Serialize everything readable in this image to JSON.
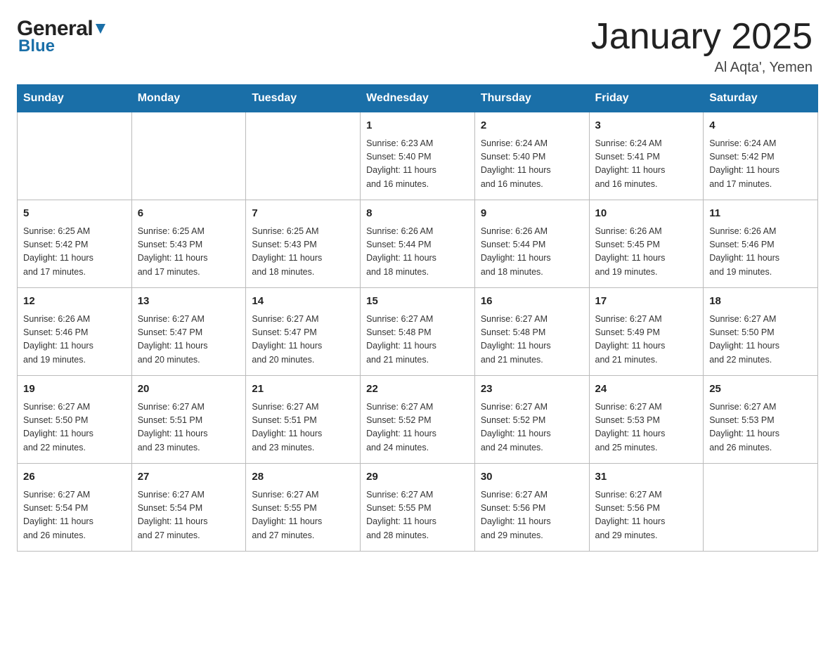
{
  "header": {
    "title": "January 2025",
    "location": "Al Aqta', Yemen",
    "logo_general": "General",
    "logo_blue": "Blue"
  },
  "weekdays": [
    "Sunday",
    "Monday",
    "Tuesday",
    "Wednesday",
    "Thursday",
    "Friday",
    "Saturday"
  ],
  "weeks": [
    [
      {
        "day": "",
        "info": ""
      },
      {
        "day": "",
        "info": ""
      },
      {
        "day": "",
        "info": ""
      },
      {
        "day": "1",
        "info": "Sunrise: 6:23 AM\nSunset: 5:40 PM\nDaylight: 11 hours\nand 16 minutes."
      },
      {
        "day": "2",
        "info": "Sunrise: 6:24 AM\nSunset: 5:40 PM\nDaylight: 11 hours\nand 16 minutes."
      },
      {
        "day": "3",
        "info": "Sunrise: 6:24 AM\nSunset: 5:41 PM\nDaylight: 11 hours\nand 16 minutes."
      },
      {
        "day": "4",
        "info": "Sunrise: 6:24 AM\nSunset: 5:42 PM\nDaylight: 11 hours\nand 17 minutes."
      }
    ],
    [
      {
        "day": "5",
        "info": "Sunrise: 6:25 AM\nSunset: 5:42 PM\nDaylight: 11 hours\nand 17 minutes."
      },
      {
        "day": "6",
        "info": "Sunrise: 6:25 AM\nSunset: 5:43 PM\nDaylight: 11 hours\nand 17 minutes."
      },
      {
        "day": "7",
        "info": "Sunrise: 6:25 AM\nSunset: 5:43 PM\nDaylight: 11 hours\nand 18 minutes."
      },
      {
        "day": "8",
        "info": "Sunrise: 6:26 AM\nSunset: 5:44 PM\nDaylight: 11 hours\nand 18 minutes."
      },
      {
        "day": "9",
        "info": "Sunrise: 6:26 AM\nSunset: 5:44 PM\nDaylight: 11 hours\nand 18 minutes."
      },
      {
        "day": "10",
        "info": "Sunrise: 6:26 AM\nSunset: 5:45 PM\nDaylight: 11 hours\nand 19 minutes."
      },
      {
        "day": "11",
        "info": "Sunrise: 6:26 AM\nSunset: 5:46 PM\nDaylight: 11 hours\nand 19 minutes."
      }
    ],
    [
      {
        "day": "12",
        "info": "Sunrise: 6:26 AM\nSunset: 5:46 PM\nDaylight: 11 hours\nand 19 minutes."
      },
      {
        "day": "13",
        "info": "Sunrise: 6:27 AM\nSunset: 5:47 PM\nDaylight: 11 hours\nand 20 minutes."
      },
      {
        "day": "14",
        "info": "Sunrise: 6:27 AM\nSunset: 5:47 PM\nDaylight: 11 hours\nand 20 minutes."
      },
      {
        "day": "15",
        "info": "Sunrise: 6:27 AM\nSunset: 5:48 PM\nDaylight: 11 hours\nand 21 minutes."
      },
      {
        "day": "16",
        "info": "Sunrise: 6:27 AM\nSunset: 5:48 PM\nDaylight: 11 hours\nand 21 minutes."
      },
      {
        "day": "17",
        "info": "Sunrise: 6:27 AM\nSunset: 5:49 PM\nDaylight: 11 hours\nand 21 minutes."
      },
      {
        "day": "18",
        "info": "Sunrise: 6:27 AM\nSunset: 5:50 PM\nDaylight: 11 hours\nand 22 minutes."
      }
    ],
    [
      {
        "day": "19",
        "info": "Sunrise: 6:27 AM\nSunset: 5:50 PM\nDaylight: 11 hours\nand 22 minutes."
      },
      {
        "day": "20",
        "info": "Sunrise: 6:27 AM\nSunset: 5:51 PM\nDaylight: 11 hours\nand 23 minutes."
      },
      {
        "day": "21",
        "info": "Sunrise: 6:27 AM\nSunset: 5:51 PM\nDaylight: 11 hours\nand 23 minutes."
      },
      {
        "day": "22",
        "info": "Sunrise: 6:27 AM\nSunset: 5:52 PM\nDaylight: 11 hours\nand 24 minutes."
      },
      {
        "day": "23",
        "info": "Sunrise: 6:27 AM\nSunset: 5:52 PM\nDaylight: 11 hours\nand 24 minutes."
      },
      {
        "day": "24",
        "info": "Sunrise: 6:27 AM\nSunset: 5:53 PM\nDaylight: 11 hours\nand 25 minutes."
      },
      {
        "day": "25",
        "info": "Sunrise: 6:27 AM\nSunset: 5:53 PM\nDaylight: 11 hours\nand 26 minutes."
      }
    ],
    [
      {
        "day": "26",
        "info": "Sunrise: 6:27 AM\nSunset: 5:54 PM\nDaylight: 11 hours\nand 26 minutes."
      },
      {
        "day": "27",
        "info": "Sunrise: 6:27 AM\nSunset: 5:54 PM\nDaylight: 11 hours\nand 27 minutes."
      },
      {
        "day": "28",
        "info": "Sunrise: 6:27 AM\nSunset: 5:55 PM\nDaylight: 11 hours\nand 27 minutes."
      },
      {
        "day": "29",
        "info": "Sunrise: 6:27 AM\nSunset: 5:55 PM\nDaylight: 11 hours\nand 28 minutes."
      },
      {
        "day": "30",
        "info": "Sunrise: 6:27 AM\nSunset: 5:56 PM\nDaylight: 11 hours\nand 29 minutes."
      },
      {
        "day": "31",
        "info": "Sunrise: 6:27 AM\nSunset: 5:56 PM\nDaylight: 11 hours\nand 29 minutes."
      },
      {
        "day": "",
        "info": ""
      }
    ]
  ],
  "colors": {
    "header_bg": "#1a6fa8",
    "border": "#bbb",
    "text_dark": "#222",
    "text_blue": "#1a6fa8"
  }
}
